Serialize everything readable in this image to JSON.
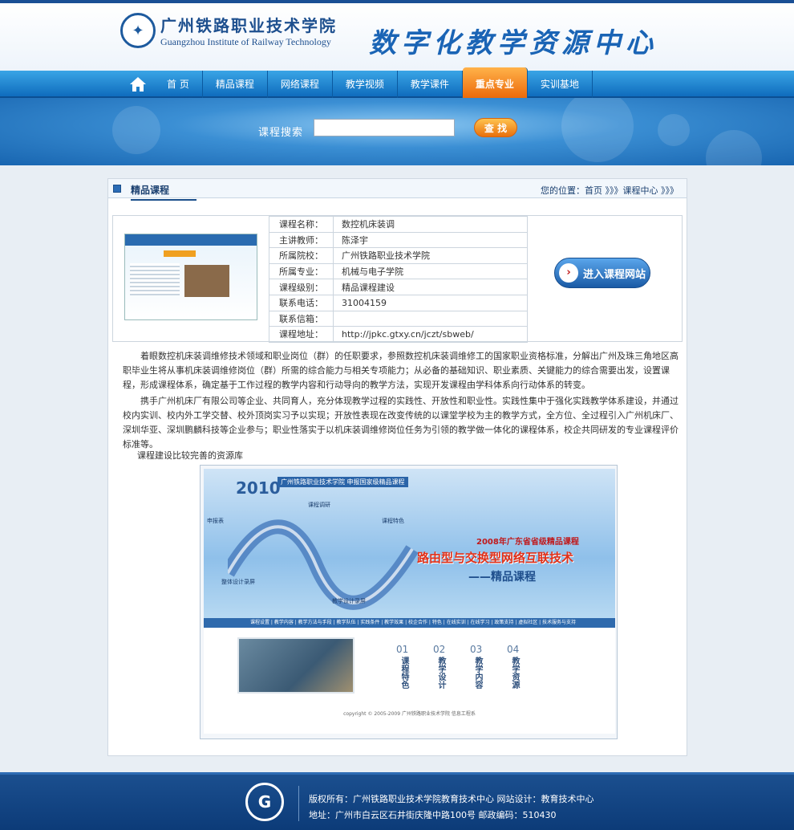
{
  "header": {
    "logo_cn": "广州铁路职业技术学院",
    "logo_en": "Guangzhou Institute of Railway Technology",
    "site_title": "数字化教学资源中心"
  },
  "nav": {
    "items": [
      "首 页",
      "精品课程",
      "网络课程",
      "教学视频",
      "教学课件",
      "重点专业",
      "实训基地"
    ],
    "active": "重点专业"
  },
  "search": {
    "label": "课程搜索",
    "placeholder": "",
    "button": "查 找"
  },
  "panel": {
    "title": "精品课程",
    "breadcrumb": "您的位置：首页 》》》课程中心 》》》"
  },
  "course": {
    "rows": [
      {
        "k": "课程名称：",
        "v": "数控机床装调"
      },
      {
        "k": "主讲教师：",
        "v": "陈泽宇"
      },
      {
        "k": "所属院校：",
        "v": "广州铁路职业技术学院"
      },
      {
        "k": "所属专业：",
        "v": "机械与电子学院"
      },
      {
        "k": "课程级别：",
        "v": "精品课程建设"
      },
      {
        "k": "联系电话：",
        "v": "31004159"
      },
      {
        "k": "联系信箱：",
        "v": ""
      },
      {
        "k": "课程地址：",
        "v": "http://jpkc.gtxy.cn/jczt/sbweb/"
      }
    ],
    "enter_button": "进入课程网站"
  },
  "description": {
    "p1": "着眼数控机床装调维修技术领域和职业岗位（群）的任职要求，参照数控机床装调维修工的国家职业资格标准，分解出广州及珠三角地区高职毕业生将从事机床装调维修岗位（群）所需的综合能力与相关专项能力；从必备的基础知识、职业素质、关键能力的综合需要出发，设置课程，形成课程体系，确定基于工作过程的教学内容和行动导向的教学方法，实现开发课程由学科体系向行动体系的转变。",
    "p2": "携手广州机床厂有限公司等企业、共同育人，充分体现教学过程的实践性、开放性和职业性。实践性集中于强化实践教学体系建设，并通过校内实训、校内外工学交替、校外顶岗实习予以实现；开放性表现在改变传统的以课堂学校为主的教学方式，全方位、全过程引入广州机床厂、深圳华亚、深圳鹏麟科技等企业参与；职业性落实于以机床装调维修岗位任务为引领的教学做一体化的课程体系，校企共同研发的专业课程评价标准等。",
    "resource_label": "课程建设比较完善的资源库"
  },
  "banner_image": {
    "year": "2010",
    "tag": "广州铁路职业技术学院 申报国家级精品课程",
    "award": "2008年广东省省级精品课程",
    "course_title": "路由型与交换型网络互联技术",
    "course_sub": "——精品课程",
    "wave_labels": [
      "课程调研",
      "课程特色",
      "整体设计录屏",
      "教学设计录屏",
      "申报表"
    ],
    "menu": "课程设置 | 教学内容 | 教学方法与手段 | 教学队伍 | 实践条件 | 教学效果 | 校企合作 | 特色 | 在线实训 | 在线学习 | 政策支持 | 虚拟社区 | 技术服务与支持",
    "numbers": [
      {
        "n": "01",
        "label": "课程特色"
      },
      {
        "n": "02",
        "label": "教学设计"
      },
      {
        "n": "03",
        "label": "教学内容"
      },
      {
        "n": "04",
        "label": "教学资源"
      }
    ],
    "copyright": "copyright © 2005-2009 广州铁路职业技术学院 信息工程系"
  },
  "footer": {
    "line1": "版权所有：广州铁路职业技术学院教育技术中心    网站设计：教育技术中心",
    "line2": "地址：广州市白云区石井街庆隆中路100号    邮政编码：510430"
  }
}
